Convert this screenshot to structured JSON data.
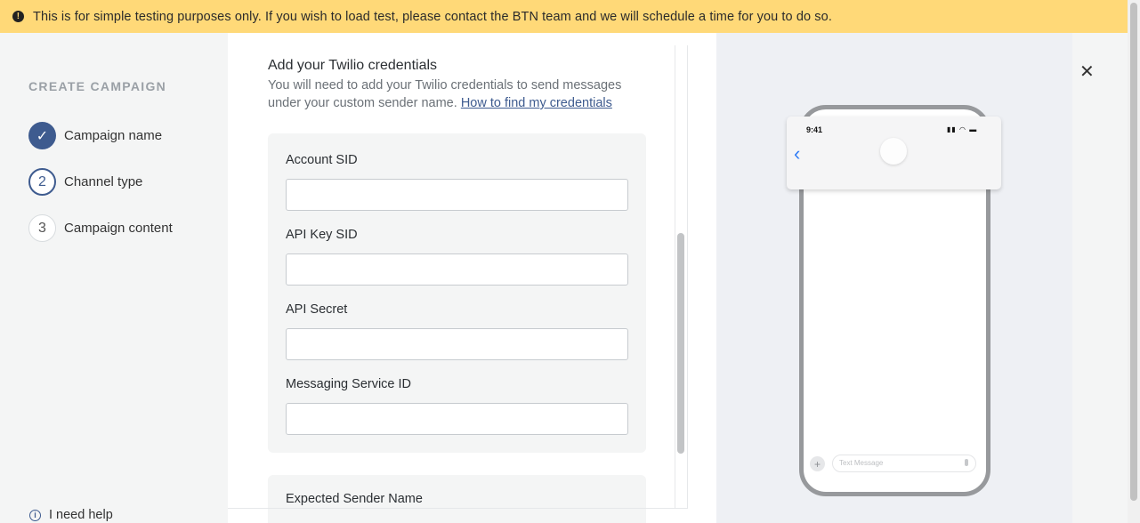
{
  "banner": {
    "icon": "exclamation-icon",
    "text": "This is for simple testing purposes only. If you wish to load test, please contact the BTN team and we will schedule a time for you to do so."
  },
  "sidebar": {
    "heading": "CREATE CAMPAIGN",
    "steps": [
      {
        "marker": "✓",
        "label": "Campaign name",
        "state": "completed"
      },
      {
        "marker": "2",
        "label": "Channel type",
        "state": "active"
      },
      {
        "marker": "3",
        "label": "Campaign content",
        "state": "pending"
      }
    ],
    "help_label": "I need help",
    "help_icon": "info-icon"
  },
  "form": {
    "title": "Add your Twilio credentials",
    "description": "You will need to add your Twilio credentials to send messages under your custom sender name.",
    "link_text": "How to find my credentials",
    "fields": [
      {
        "label": "Account SID",
        "value": ""
      },
      {
        "label": "API Key SID",
        "value": ""
      },
      {
        "label": "API Secret",
        "value": ""
      },
      {
        "label": "Messaging Service ID",
        "value": ""
      }
    ],
    "next_section_label": "Expected Sender Name"
  },
  "preview": {
    "close_icon": "close-icon",
    "phone": {
      "time": "9:41",
      "status_icons": "signal-wifi-battery",
      "message_placeholder": "Text Message"
    }
  },
  "colors": {
    "banner": "#ffd978",
    "accent": "#3e5b8f",
    "link": "#3e5b8f"
  }
}
